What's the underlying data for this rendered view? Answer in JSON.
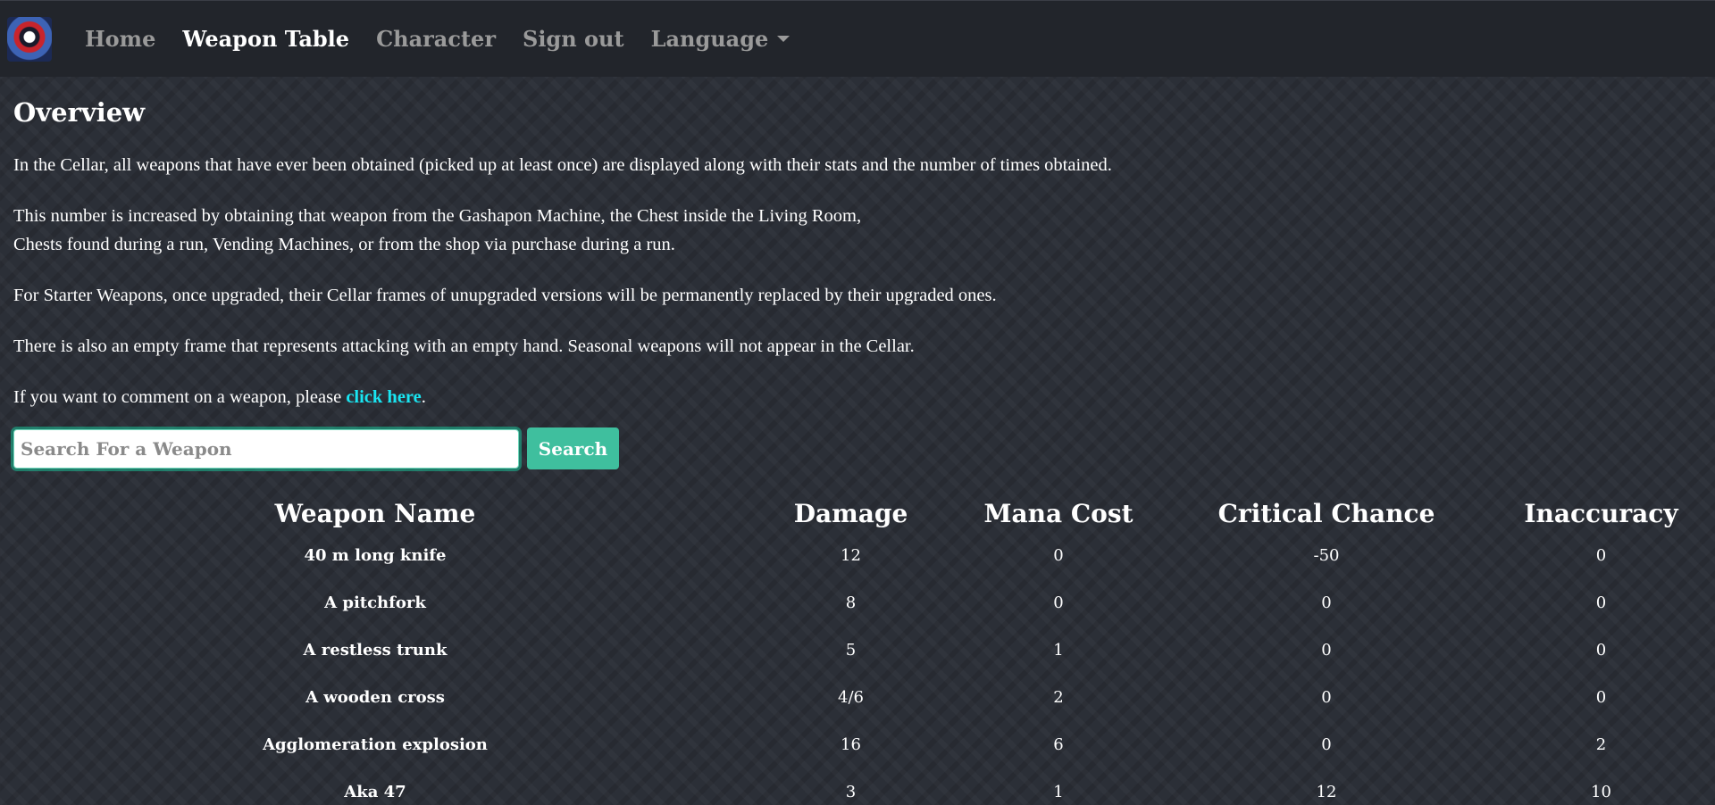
{
  "nav": {
    "items": [
      {
        "label": "Home",
        "active": false
      },
      {
        "label": "Weapon Table",
        "active": true
      },
      {
        "label": "Character",
        "active": false
      },
      {
        "label": "Sign out",
        "active": false
      },
      {
        "label": "Language",
        "active": false,
        "dropdown": true
      }
    ]
  },
  "overview": {
    "title": "Overview",
    "p1": "In the Cellar, all weapons that have ever been obtained (picked up at least once) are displayed along with their stats and the number of times obtained.",
    "p2_line1": "This number is increased by obtaining that weapon from the Gashapon Machine, the Chest inside the Living Room,",
    "p2_line2": "Chests found during a run, Vending Machines, or from the shop via purchase during a run.",
    "p3": "For Starter Weapons, once upgraded, their Cellar frames of unupgraded versions will be permanently replaced by their upgraded ones.",
    "p4": "There is also an empty frame that represents attacking with an empty hand. Seasonal weapons will not appear in the Cellar.",
    "p5_before": "If you want to comment on a weapon, please ",
    "p5_link": "click here",
    "p5_after": "."
  },
  "search": {
    "placeholder": "Search For a Weapon",
    "button_label": "Search"
  },
  "table": {
    "headers": [
      "Weapon Name",
      "Damage",
      "Mana Cost",
      "Critical Chance",
      "Inaccuracy"
    ],
    "rows": [
      [
        "40 m long knife",
        "12",
        "0",
        "-50",
        "0"
      ],
      [
        "A pitchfork",
        "8",
        "0",
        "0",
        "0"
      ],
      [
        "A restless trunk",
        "5",
        "1",
        "0",
        "0"
      ],
      [
        "A wooden cross",
        "4/6",
        "2",
        "0",
        "0"
      ],
      [
        "Agglomeration explosion",
        "16",
        "6",
        "0",
        "2"
      ],
      [
        "Aka 47",
        "3",
        "1",
        "12",
        "10"
      ]
    ]
  },
  "colors": {
    "link": "#19e6f2",
    "accent": "#3fbf9e",
    "navbar": "#22252b",
    "background": "#2b2f37"
  },
  "icons": {
    "logo": "game-logo-icon",
    "language_caret": "caret-down-icon"
  }
}
